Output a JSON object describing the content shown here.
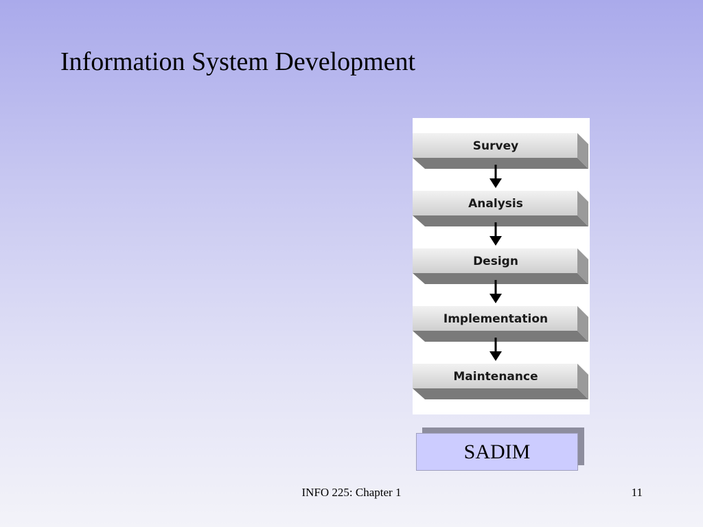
{
  "slide": {
    "title": "Information System Development",
    "footer_center": "INFO 225: Chapter 1",
    "page_number": "11"
  },
  "diagram": {
    "steps": [
      "Survey",
      "Analysis",
      "Design",
      "Implementation",
      "Maintenance"
    ]
  },
  "callout": {
    "label": "SADIM"
  },
  "colors": {
    "background_top": "#aaaaeb",
    "background_bottom": "#f3f3f9",
    "callout_fill": "#ccccff",
    "step_face": "#dcdcdc",
    "step_shadow": "#7a7a7a"
  }
}
